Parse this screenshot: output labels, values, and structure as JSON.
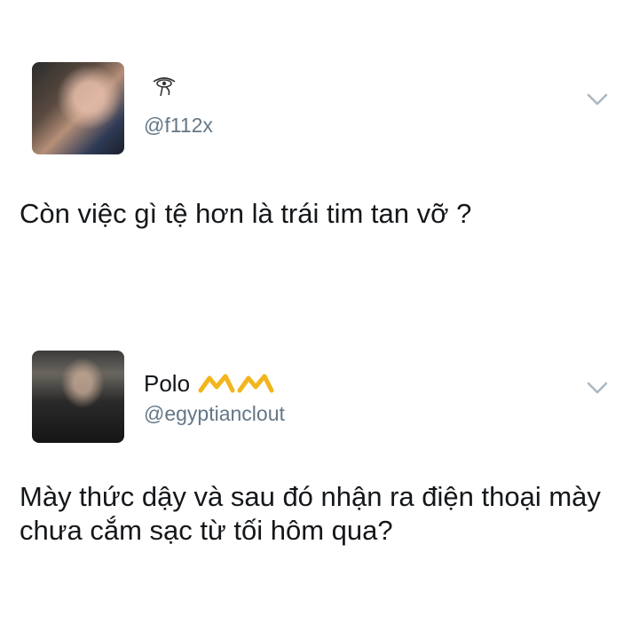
{
  "tweets": [
    {
      "display_name": "",
      "name_icon": "eye-of-horus-icon",
      "handle": "@f112x",
      "text": "Còn việc gì tệ hơn là trái tim tan vỡ ?",
      "menu_icon": "chevron-down-icon"
    },
    {
      "display_name": "Polo",
      "name_icon": "crown-emoji-icon",
      "handle": "@egyptianclout",
      "text": "Mày thức dậy và sau đó nhận ra điện thoại mày chưa cắm sạc từ tối hôm qua?",
      "menu_icon": "chevron-down-icon"
    }
  ],
  "colors": {
    "text": "#14171a",
    "handle": "#657786",
    "chevron": "#aab8c2",
    "emoji": "#f2b51d"
  }
}
